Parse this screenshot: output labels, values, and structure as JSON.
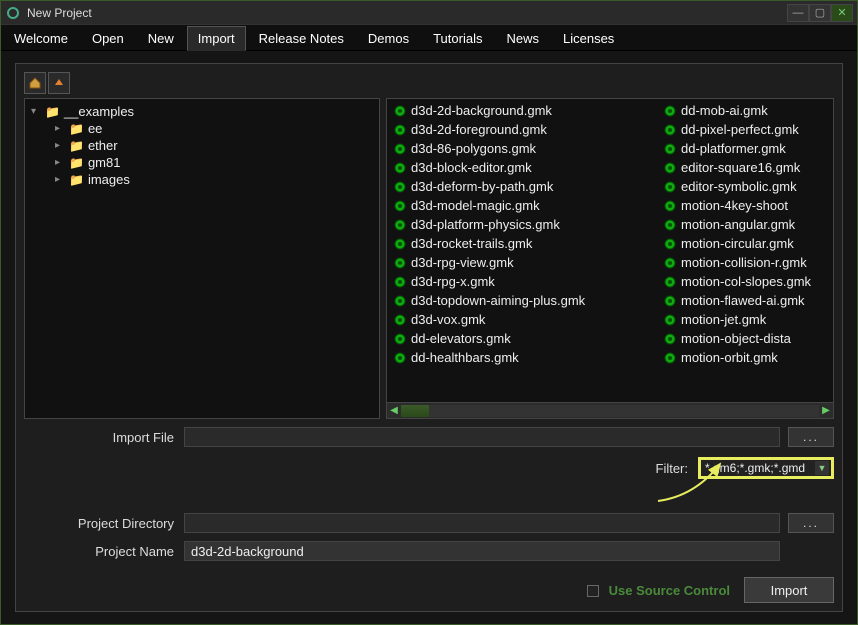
{
  "window": {
    "title": "New Project"
  },
  "tabs": [
    {
      "label": "Welcome"
    },
    {
      "label": "Open"
    },
    {
      "label": "New"
    },
    {
      "label": "Import"
    },
    {
      "label": "Release Notes"
    },
    {
      "label": "Demos"
    },
    {
      "label": "Tutorials"
    },
    {
      "label": "News"
    },
    {
      "label": "Licenses"
    }
  ],
  "active_tab": "Import",
  "tree": {
    "root": "__examples",
    "children": [
      {
        "name": "ee"
      },
      {
        "name": "ether"
      },
      {
        "name": "gm81"
      },
      {
        "name": "images"
      }
    ]
  },
  "files_col1": [
    "d3d-2d-background.gmk",
    "d3d-2d-foreground.gmk",
    "d3d-86-polygons.gmk",
    "d3d-block-editor.gmk",
    "d3d-deform-by-path.gmk",
    "d3d-model-magic.gmk",
    "d3d-platform-physics.gmk",
    "d3d-rocket-trails.gmk",
    "d3d-rpg-view.gmk",
    "d3d-rpg-x.gmk",
    "d3d-topdown-aiming-plus.gmk",
    "d3d-vox.gmk",
    "dd-elevators.gmk",
    "dd-healthbars.gmk"
  ],
  "files_col2": [
    "dd-mob-ai.gmk",
    "dd-pixel-perfect.gmk",
    "dd-platformer.gmk",
    "editor-square16.gmk",
    "editor-symbolic.gmk",
    "motion-4key-shoot",
    "motion-angular.gmk",
    "motion-circular.gmk",
    "motion-collision-r.gmk",
    "motion-col-slopes.gmk",
    "motion-flawed-ai.gmk",
    "motion-jet.gmk",
    "motion-object-dista",
    "motion-orbit.gmk"
  ],
  "form": {
    "import_file_label": "Import File",
    "import_file_value": "",
    "filter_label": "Filter:",
    "filter_value": "*.gm6;*.gmk;*.gmd",
    "project_dir_label": "Project Directory",
    "project_dir_value": "",
    "project_name_label": "Project Name",
    "project_name_value": "d3d-2d-background",
    "browse": "...",
    "use_source_control": "Use Source Control",
    "import_button": "Import"
  }
}
